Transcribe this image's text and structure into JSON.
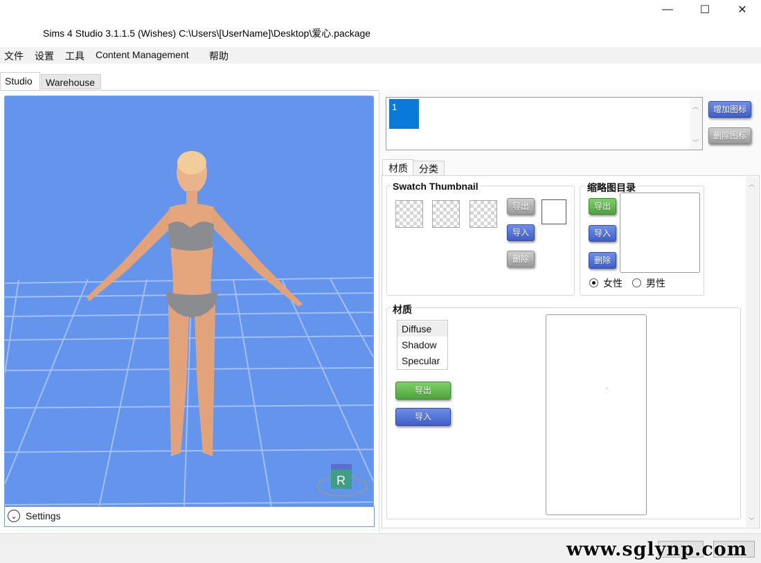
{
  "window": {
    "title": "Sims 4 Studio 3.1.1.5 (Wishes)  C:\\Users\\[UserName]\\Desktop\\爱心.package",
    "controls": {
      "minimize": "—",
      "maximize": "☐",
      "close": "✕"
    }
  },
  "menu": [
    "文件",
    "设置",
    "工具",
    "Content Management",
    "帮助"
  ],
  "main_tabs": [
    "Studio",
    "Warehouse"
  ],
  "viewport": {
    "settings_label": "Settings",
    "cube_letter": "R",
    "background_color": "#6495ed"
  },
  "swatches": {
    "items": [
      "1"
    ],
    "add_button": "增加图标",
    "delete_button": "删除图标"
  },
  "sub_tabs": [
    "材质",
    "分类"
  ],
  "swatch_thumbnail": {
    "title": "Swatch Thumbnail",
    "export": "导出",
    "import": "导入",
    "delete": "删除"
  },
  "thumbnail_catalog": {
    "title": "缩略图目录",
    "export": "导出",
    "import": "导入",
    "delete": "删除",
    "gender_options": [
      "女性",
      "男性"
    ],
    "selected_gender": "女性"
  },
  "material": {
    "title": "材质",
    "items": [
      "Diffuse",
      "Shadow",
      "Specular"
    ],
    "export": "导出",
    "import": "导入",
    "preview_dot": "·"
  },
  "watermark": "www.sglynp.com"
}
